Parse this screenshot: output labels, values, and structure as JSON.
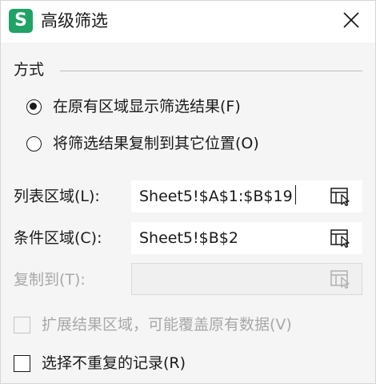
{
  "window": {
    "app_icon_letter": "S",
    "title": "高级筛选",
    "close_icon": "close-icon",
    "accent_color": "#21a366"
  },
  "method": {
    "label": "方式",
    "options": [
      {
        "label": "在原有区域显示筛选结果(F)",
        "checked": true
      },
      {
        "label": "将筛选结果复制到其它位置(O)",
        "checked": false
      }
    ]
  },
  "list_range": {
    "label": "列表区域(L):",
    "value": "Sheet5!$A$1:$B$19",
    "button_icon": "range-select-icon"
  },
  "criteria_range": {
    "label": "条件区域(C):",
    "value": "Sheet5!$B$2",
    "button_icon": "range-select-icon"
  },
  "copy_to": {
    "label": "复制到(T):",
    "value": "",
    "disabled": true,
    "button_icon": "range-select-icon"
  },
  "options": {
    "extend_results": {
      "label": "扩展结果区域，可能覆盖原有数据(V)",
      "checked": false,
      "disabled": true
    },
    "unique_records": {
      "label": "选择不重复的记录(R)",
      "checked": false,
      "disabled": false
    }
  }
}
